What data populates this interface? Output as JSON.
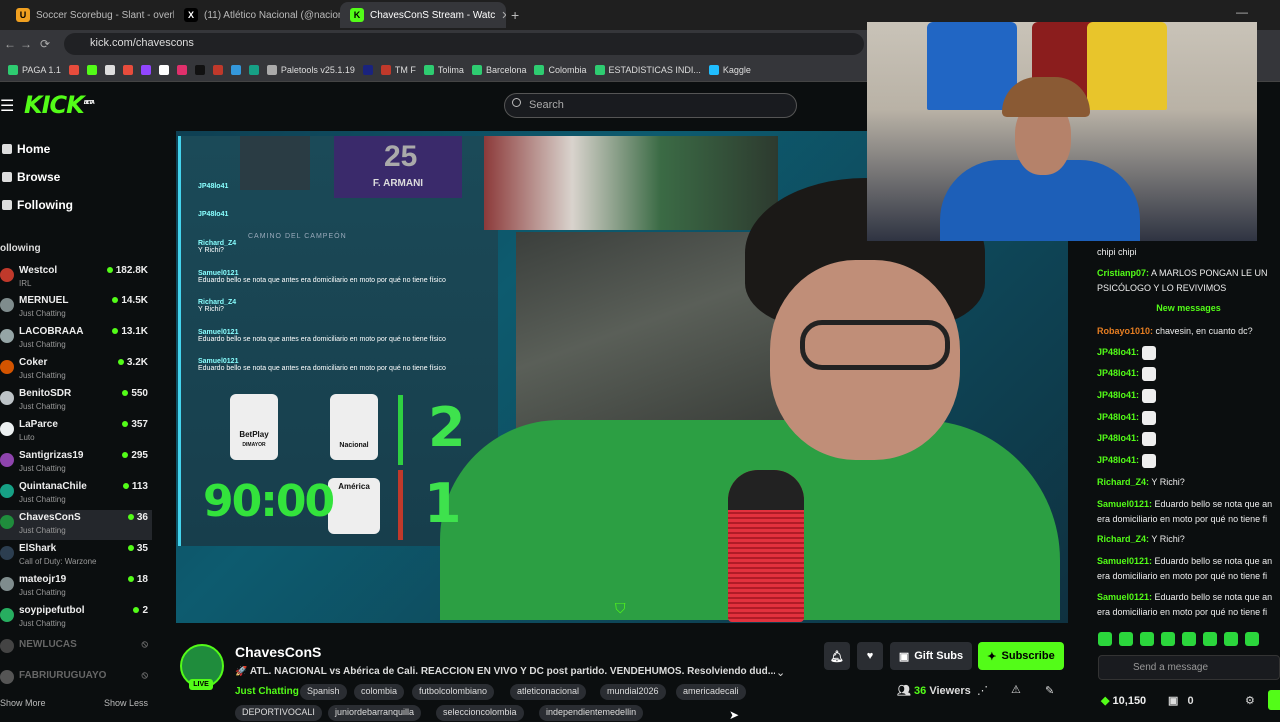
{
  "browser": {
    "tabs": [
      {
        "label": "Soccer Scorebug - Slant - overl",
        "favicon": "U",
        "color": "#f0a020"
      },
      {
        "label": "(11) Atlético Nacional (@nacion",
        "favicon": "X",
        "color": "#000000"
      },
      {
        "label": "ChavesConS Stream - Watc",
        "favicon": "K",
        "color": "#53fc18"
      }
    ],
    "url": "kick.com/chavescons",
    "bookmarks": [
      "PAGA 1.1",
      "Paletools v25.1.19",
      "TM F",
      "Tolima",
      "Barcelona",
      "Colombia",
      "ESTADISTICAS INDI...",
      "Kaggle"
    ]
  },
  "kick": {
    "logo": "KICK",
    "logo_sup": "BETA",
    "search_placeholder": "Search"
  },
  "sidebar": {
    "nav": [
      "Home",
      "Browse",
      "Following"
    ],
    "following_header": "ollowing",
    "channels": [
      {
        "name": "Westcol",
        "category": "IRL",
        "viewers": "182.8K",
        "color": "#c0392b"
      },
      {
        "name": "MERNUEL",
        "category": "Just Chatting",
        "viewers": "14.5K",
        "color": "#7f8c8d"
      },
      {
        "name": "LACOBRAAA",
        "category": "Just Chatting",
        "viewers": "13.1K",
        "color": "#95a5a6"
      },
      {
        "name": "Coker",
        "category": "Just Chatting",
        "viewers": "3.2K",
        "color": "#d35400"
      },
      {
        "name": "BenitoSDR",
        "category": "Just Chatting",
        "viewers": "550",
        "color": "#bdc3c7"
      },
      {
        "name": "LaParce",
        "category": "Luto",
        "viewers": "357",
        "color": "#ecf0f1"
      },
      {
        "name": "Santigrizas19",
        "category": "Just Chatting",
        "viewers": "295",
        "color": "#8e44ad"
      },
      {
        "name": "QuintanaChile",
        "category": "Just Chatting",
        "viewers": "113",
        "color": "#16a085"
      },
      {
        "name": "ChavesConS",
        "category": "Just Chatting",
        "viewers": "36",
        "color": "#1f8c3c"
      },
      {
        "name": "ElShark",
        "category": "Call of Duty: Warzone",
        "viewers": "35",
        "color": "#2c3e50"
      },
      {
        "name": "mateojr19",
        "category": "Just Chatting",
        "viewers": "18",
        "color": "#7f8c8d"
      },
      {
        "name": "soypipefutbol",
        "category": "Just Chatting",
        "viewers": "2",
        "color": "#27ae60"
      }
    ],
    "offline": [
      "NEWLUCAS",
      "FABRIURUGUAYO"
    ],
    "show_more": "Show More",
    "show_less": "Show Less"
  },
  "video": {
    "overlay_chat": [
      {
        "user": "JP48lo41",
        "text": ""
      },
      {
        "user": "JP48lo41",
        "text": ""
      },
      {
        "user": "Richard_Z4",
        "text": "Y Richi?"
      },
      {
        "user": "Samuel0121",
        "text": "Eduardo bello se nota que antes era domiciliario en moto por qué no tiene físico"
      },
      {
        "user": "Richard_Z4",
        "text": "Y Richi?"
      },
      {
        "user": "Samuel0121",
        "text": "Eduardo bello se nota que antes era domiciliario en moto por qué no tiene físico"
      },
      {
        "user": "Samuel0121",
        "text": "Eduardo bello se nota que antes era domiciliario en moto por qué no tiene físico"
      }
    ],
    "campeon_label": "CAMINO DEL CAMPEÓN",
    "player_label": "F. ARMANI",
    "player_number": "25",
    "league": "BetPlay",
    "league_sub": "DIMAYOR",
    "match_time": "90:00",
    "home_score": "2",
    "away_score": "1",
    "home_team": "Nacional",
    "away_team": "América"
  },
  "chat": {
    "messages": [
      {
        "user": "",
        "text": "chipi chipi",
        "color": "#eeeeee"
      },
      {
        "user": "Cristianp07:",
        "text": " A MARLOS PONGAN LE UN",
        "color": "#53fc18"
      },
      {
        "user": "",
        "text": "PSICÓLOGO Y LO REVIVIMOS",
        "color": "#eeeeee"
      },
      {
        "user": "Robayo1010:",
        "text": " chavesin, en cuanto dc?",
        "color": "#e67e22"
      },
      {
        "user": "JP48lo41:",
        "text": "",
        "color": "#53fc18"
      },
      {
        "user": "JP48lo41:",
        "text": "",
        "color": "#53fc18"
      },
      {
        "user": "JP48lo41:",
        "text": "",
        "color": "#53fc18"
      },
      {
        "user": "JP48lo41:",
        "text": "",
        "color": "#53fc18"
      },
      {
        "user": "JP48lo41:",
        "text": "",
        "color": "#53fc18"
      },
      {
        "user": "JP48lo41:",
        "text": "",
        "color": "#53fc18"
      },
      {
        "user": "Richard_Z4:",
        "text": " Y Richi?",
        "color": "#53fc18"
      },
      {
        "user": "Samuel0121:",
        "text": " Eduardo bello se nota que an",
        "color": "#53fc18"
      },
      {
        "user": "",
        "text": "era domiciliario en moto por qué no tiene fi",
        "color": "#eeeeee"
      },
      {
        "user": "Richard_Z4:",
        "text": " Y Richi?",
        "color": "#53fc18"
      },
      {
        "user": "Samuel0121:",
        "text": " Eduardo bello se nota que an",
        "color": "#53fc18"
      },
      {
        "user": "",
        "text": "era domiciliario en moto por qué no tiene fi",
        "color": "#eeeeee"
      },
      {
        "user": "Samuel0121:",
        "text": " Eduardo bello se nota que an",
        "color": "#53fc18"
      },
      {
        "user": "",
        "text": "era domiciliario en moto por qué no tiene fi",
        "color": "#eeeeee"
      }
    ],
    "new_messages": "New messages",
    "send_placeholder": "Send a message",
    "coins": "10,150",
    "points": "0"
  },
  "stream": {
    "name": "ChavesConS",
    "live": "LIVE",
    "title": "🚀 ATL. NACIONAL vs Abérica de Cali. REACCION EN VIVO Y DC post partido. VENDEHUMOS. Resolviendo dud...",
    "category": "Just Chatting",
    "tags": [
      "Spanish",
      "colombia",
      "futbolcolombiano",
      "atleticonacional",
      "mundial2026",
      "americadecali",
      "DEPORTIVOCALI",
      "juniordebarranquilla",
      "seleccioncolombia",
      "independientemedellin"
    ],
    "gift_label": "Gift Subs",
    "subscribe_label": "Subscribe",
    "viewers": "36",
    "viewers_label": "Viewers"
  },
  "colors": {
    "accent": "#53fc18",
    "background": "#0b0e0f"
  }
}
